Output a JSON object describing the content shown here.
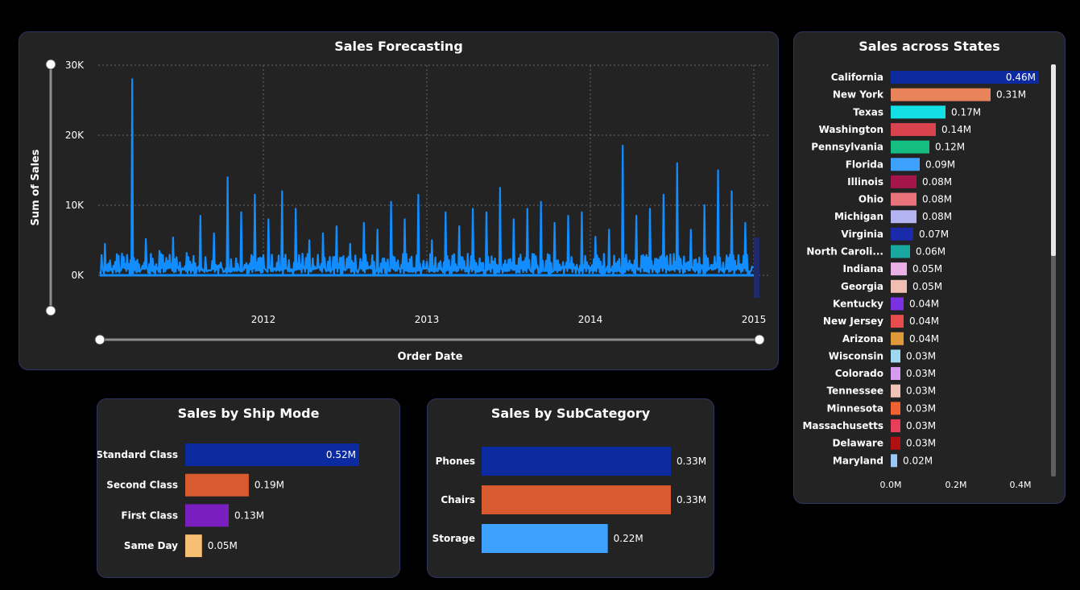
{
  "forecast": {
    "title": "Sales Forecasting",
    "ylabel": "Sum of Sales",
    "xlabel": "Order Date",
    "ytick_labels": [
      "30K",
      "20K",
      "10K",
      "0K"
    ],
    "xtick_labels": [
      "2012",
      "2013",
      "2014",
      "2015"
    ],
    "series_color": "#118dff",
    "chart_data": {
      "type": "line",
      "x": [
        "2011-01",
        "2011-02",
        "2011-03",
        "2011-04",
        "2011-05",
        "2011-06",
        "2011-07",
        "2011-08",
        "2011-09",
        "2011-10",
        "2011-11",
        "2011-12",
        "2012-01",
        "2012-02",
        "2012-03",
        "2012-04",
        "2012-05",
        "2012-06",
        "2012-07",
        "2012-08",
        "2012-09",
        "2012-10",
        "2012-11",
        "2012-12",
        "2013-01",
        "2013-02",
        "2013-03",
        "2013-04",
        "2013-05",
        "2013-06",
        "2013-07",
        "2013-08",
        "2013-09",
        "2013-10",
        "2013-11",
        "2013-12",
        "2014-01",
        "2014-02",
        "2014-03",
        "2014-04",
        "2014-05",
        "2014-06",
        "2014-07",
        "2014-08",
        "2014-09",
        "2014-10",
        "2014-11",
        "2014-12"
      ],
      "y": [
        4500,
        2800,
        28000,
        5200,
        3500,
        5400,
        3200,
        8500,
        6000,
        14000,
        9000,
        11500,
        8000,
        12000,
        9500,
        5000,
        6000,
        7000,
        4500,
        7500,
        6500,
        10500,
        8000,
        11500,
        5000,
        9000,
        7000,
        9500,
        9000,
        12500,
        8000,
        9500,
        10500,
        7500,
        8500,
        9000,
        5500,
        6500,
        18500,
        8500,
        9500,
        11500,
        16000,
        6500,
        10000,
        15000,
        12000,
        7500
      ],
      "ylim": [
        0,
        30000
      ],
      "grid": true
    }
  },
  "states": {
    "title": "Sales across States",
    "axis_labels": [
      "0.0M",
      "0.2M",
      "0.4M"
    ],
    "chart_data": {
      "type": "bar",
      "orientation": "horizontal",
      "categories": [
        "California",
        "New York",
        "Texas",
        "Washington",
        "Pennsylvania",
        "Florida",
        "Illinois",
        "Ohio",
        "Michigan",
        "Virginia",
        "North Caroli...",
        "Indiana",
        "Georgia",
        "Kentucky",
        "New Jersey",
        "Arizona",
        "Wisconsin",
        "Colorado",
        "Tennessee",
        "Minnesota",
        "Massachusetts",
        "Delaware",
        "Maryland"
      ],
      "values": [
        0.46,
        0.31,
        0.17,
        0.14,
        0.12,
        0.09,
        0.08,
        0.08,
        0.08,
        0.07,
        0.06,
        0.05,
        0.05,
        0.04,
        0.04,
        0.04,
        0.03,
        0.03,
        0.03,
        0.03,
        0.03,
        0.03,
        0.02
      ],
      "labels": [
        "0.46M",
        "0.31M",
        "0.17M",
        "0.14M",
        "0.12M",
        "0.09M",
        "0.08M",
        "0.08M",
        "0.08M",
        "0.07M",
        "0.06M",
        "0.05M",
        "0.05M",
        "0.04M",
        "0.04M",
        "0.04M",
        "0.03M",
        "0.03M",
        "0.03M",
        "0.03M",
        "0.03M",
        "0.03M",
        "0.02M"
      ],
      "colors": [
        "#0d2ba1",
        "#e8845c",
        "#13e0e4",
        "#d9434d",
        "#15bd83",
        "#3fa1ff",
        "#a4154a",
        "#e8737a",
        "#b4b4f2",
        "#1a2aa8",
        "#18a89f",
        "#e9b0e6",
        "#f1bfb2",
        "#7b31e3",
        "#e84c4c",
        "#e0993a",
        "#a0d8f2",
        "#d49df0",
        "#f1c4b8",
        "#f26133",
        "#e83e5a",
        "#b01010",
        "#9ac8f7"
      ],
      "xlim": [
        0,
        0.46
      ]
    }
  },
  "shipmode": {
    "title": "Sales by Ship Mode",
    "chart_data": {
      "type": "bar",
      "orientation": "horizontal",
      "categories": [
        "Standard Class",
        "Second Class",
        "First Class",
        "Same Day"
      ],
      "values": [
        0.52,
        0.19,
        0.13,
        0.05
      ],
      "labels": [
        "0.52M",
        "0.19M",
        "0.13M",
        "0.05M"
      ],
      "colors": [
        "#0d2ba1",
        "#d85b2f",
        "#7a1fbf",
        "#f7bf72"
      ],
      "xlim": [
        0,
        0.52
      ]
    }
  },
  "subcategory": {
    "title": "Sales by SubCategory",
    "chart_data": {
      "type": "bar",
      "orientation": "horizontal",
      "categories": [
        "Phones",
        "Chairs",
        "Storage"
      ],
      "values": [
        0.33,
        0.33,
        0.22
      ],
      "labels": [
        "0.33M",
        "0.33M",
        "0.22M"
      ],
      "colors": [
        "#0d2ba1",
        "#d85b2f",
        "#3fa1ff"
      ],
      "xlim": [
        0,
        0.33
      ]
    }
  }
}
